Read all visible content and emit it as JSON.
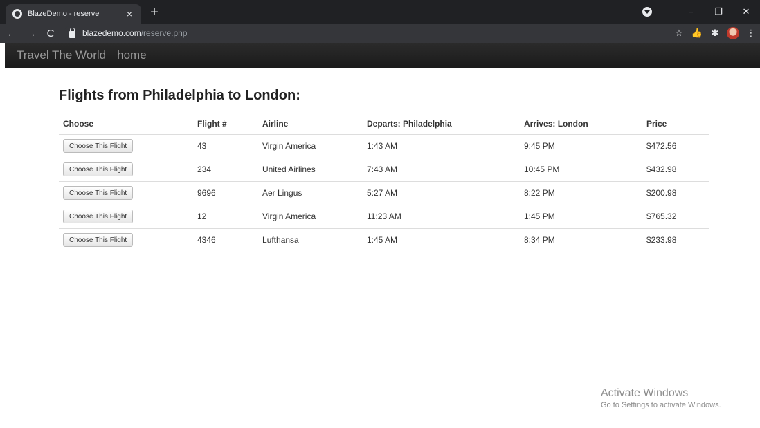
{
  "browser": {
    "tab_title": "BlazeDemo - reserve",
    "tab_close": "×",
    "new_tab": "+",
    "url_host": "blazedemo.com",
    "url_path": "/reserve.php",
    "back": "←",
    "forward": "→",
    "reload": "C",
    "bookmark": "☆",
    "ext_hand": "👍",
    "extensions": "✱",
    "menu": "⋮",
    "minimize": "−",
    "restore": "❐",
    "close": "✕"
  },
  "navbar": {
    "brand": "Travel The World",
    "home": "home"
  },
  "page": {
    "heading": "Flights from Philadelphia to London:",
    "columns": [
      "Choose",
      "Flight #",
      "Airline",
      "Departs: Philadelphia",
      "Arrives: London",
      "Price"
    ],
    "button_label": "Choose This Flight",
    "rows": [
      {
        "flight": "43",
        "airline": "Virgin America",
        "departs": "1:43 AM",
        "arrives": "9:45 PM",
        "price": "$472.56"
      },
      {
        "flight": "234",
        "airline": "United Airlines",
        "departs": "7:43 AM",
        "arrives": "10:45 PM",
        "price": "$432.98"
      },
      {
        "flight": "9696",
        "airline": "Aer Lingus",
        "departs": "5:27 AM",
        "arrives": "8:22 PM",
        "price": "$200.98"
      },
      {
        "flight": "12",
        "airline": "Virgin America",
        "departs": "11:23 AM",
        "arrives": "1:45 PM",
        "price": "$765.32"
      },
      {
        "flight": "4346",
        "airline": "Lufthansa",
        "departs": "1:45 AM",
        "arrives": "8:34 PM",
        "price": "$233.98"
      }
    ]
  },
  "watermark": {
    "line1": "Activate Windows",
    "line2": "Go to Settings to activate Windows."
  }
}
